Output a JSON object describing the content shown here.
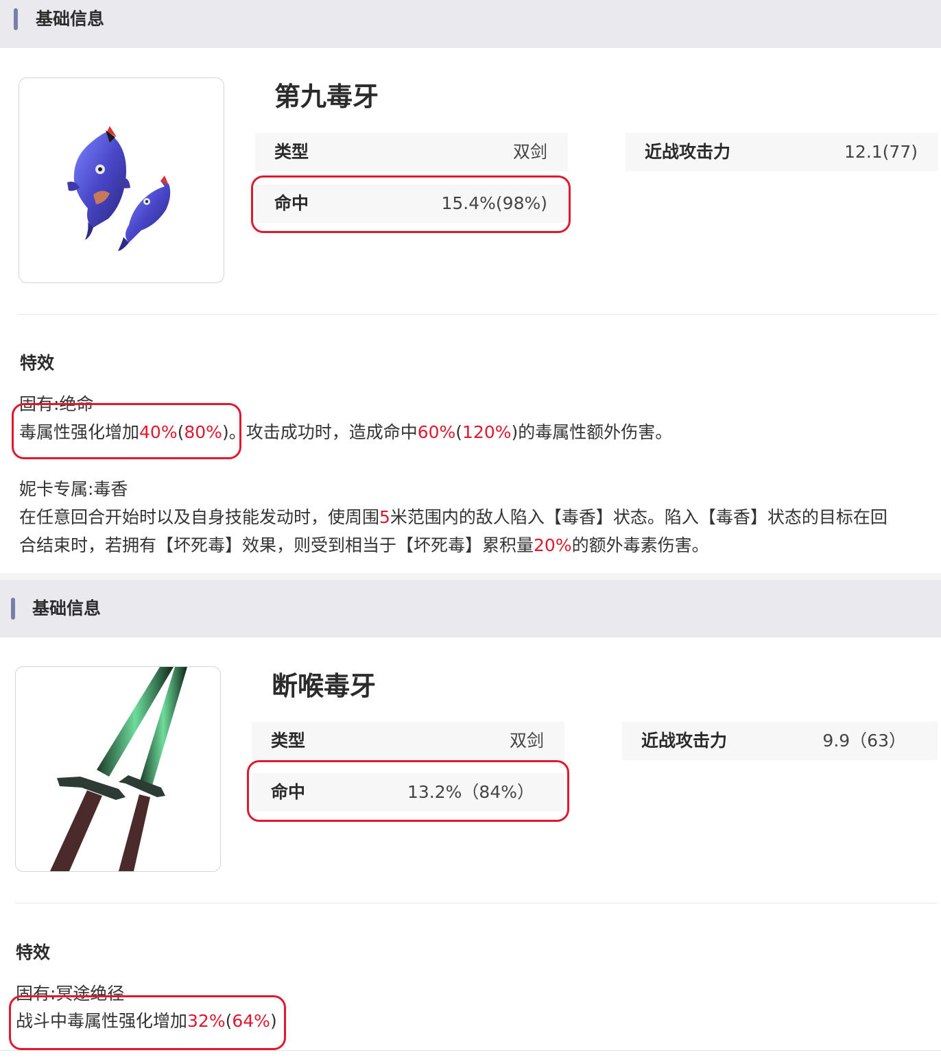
{
  "colors": {
    "accent": "#7a7fa8",
    "highlight": "#e0182d",
    "header_bg": "#e9e9ee"
  },
  "items": [
    {
      "section_title": "基础信息",
      "image_icon": "twin-fish-blades-icon",
      "name": "第九毒牙",
      "type_label": "类型",
      "type_value": "双剑",
      "hit_label": "命中",
      "hit_value": "15.4%(98%)",
      "attack_label": "近战攻击力",
      "attack_value": "12.1(77)",
      "effects_title": "特效",
      "inherent_title": "固有:绝命",
      "inherent_p1": "毒属性强化增加",
      "inherent_v1": "40%",
      "inherent_p2": "(",
      "inherent_v2": "80%",
      "inherent_p3": ")。攻击成功时，造成命中",
      "inherent_v3": "60%",
      "inherent_p4": "(",
      "inherent_v4": "120%",
      "inherent_p5": ")的毒属性额外伤害。",
      "exclusive_title": "妮卡专属:毒香",
      "exclusive_l1_a": "在任意回合开始时以及自身技能发动时，使周围",
      "exclusive_l1_v": "5",
      "exclusive_l1_b": "米范围内的敌人陷入【毒香】状态。陷入【毒香】状态的目标在回",
      "exclusive_l2_a": "合结束时，若拥有【坏死毒】效果，则受到相当于【坏死毒】累积量",
      "exclusive_l2_v": "20%",
      "exclusive_l2_b": "的额外毒素伤害。"
    },
    {
      "section_title": "基础信息",
      "image_icon": "twin-daggers-icon",
      "name": "断喉毒牙",
      "type_label": "类型",
      "type_value": "双剑",
      "hit_label": "命中",
      "hit_value": "13.2%（84%）",
      "attack_label": "近战攻击力",
      "attack_value": "9.9（63）",
      "effects_title": "特效",
      "inherent_title": "固有:冥途绝径",
      "inherent_p1": "战斗中毒属性强化增加",
      "inherent_v1": "32%",
      "inherent_p2": "(",
      "inherent_v2": "64%",
      "inherent_p3": ")"
    }
  ]
}
